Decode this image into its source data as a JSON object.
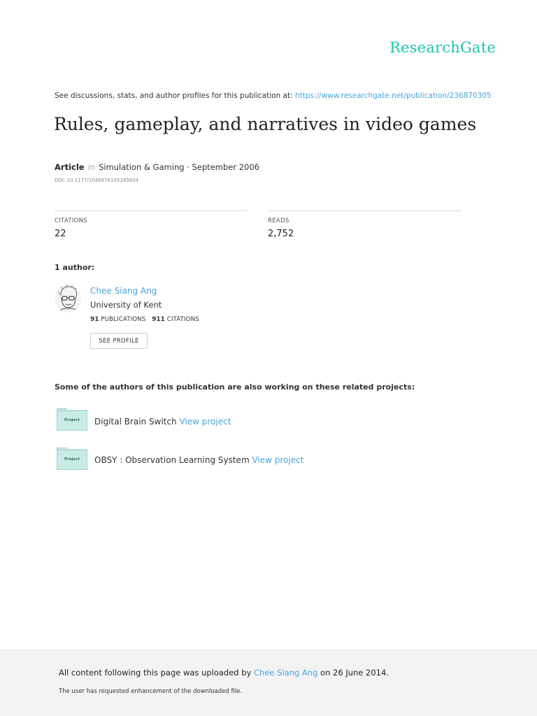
{
  "brand": "ResearchGate",
  "discussion": {
    "prefix": "See discussions, stats, and author profiles for this publication at: ",
    "url": "https://www.researchgate.net/publication/236870305"
  },
  "title": "Rules, gameplay, and narratives in video games",
  "meta": {
    "type": "Article",
    "in_word": "in",
    "journal": "Simulation & Gaming · September 2006",
    "doi": "DOI: 10.1177/1046878105285604"
  },
  "stats": {
    "citations_label": "CITATIONS",
    "citations_value": "22",
    "reads_label": "READS",
    "reads_value": "2,752"
  },
  "authors_heading": "1 author:",
  "author": {
    "name": "Chee Siang Ang",
    "institution": "University of Kent",
    "publications_count": "91",
    "publications_label": "PUBLICATIONS",
    "citations_count": "911",
    "citations_label": "CITATIONS",
    "profile_button": "SEE PROFILE"
  },
  "projects_heading": "Some of the authors of this publication are also working on these related projects:",
  "projects": [
    {
      "icon_label": "Project",
      "name": "Digital Brain Switch",
      "link": "View project"
    },
    {
      "icon_label": "Project",
      "name": "OBSY : Observation Learning System",
      "link": "View project"
    }
  ],
  "footer": {
    "prefix": "All content following this page was uploaded by ",
    "uploader": "Chee Siang Ang",
    "suffix": " on 26 June 2014.",
    "note": "The user has requested enhancement of the downloaded file."
  },
  "colors": {
    "brand": "#1fc5a4",
    "link": "#48a6d9",
    "project_folder": "#c9ebe6"
  }
}
